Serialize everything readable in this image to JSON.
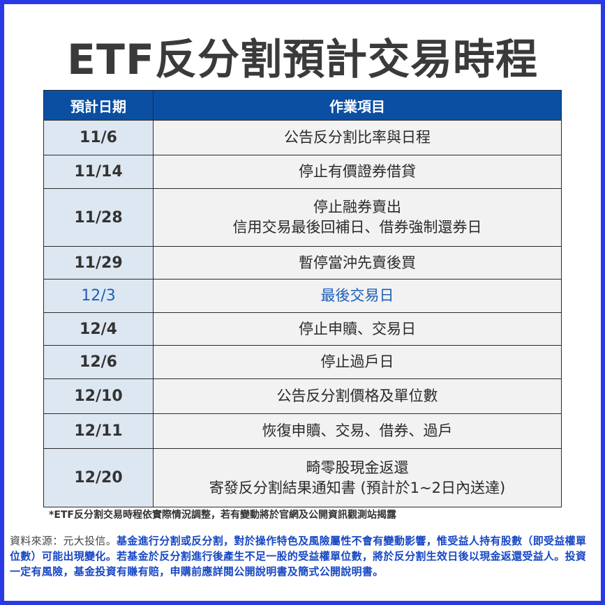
{
  "title": "ETF反分割預計交易時程",
  "table": {
    "headers": [
      "預計日期",
      "作業項目"
    ],
    "rows": [
      {
        "date": "11/6",
        "lines": [
          "公告反分割比率與日程"
        ]
      },
      {
        "date": "11/14",
        "lines": [
          "停止有價證券借貸"
        ]
      },
      {
        "date": "11/28",
        "lines": [
          "停止融券賣出",
          "信用交易最後回補日、借券強制還券日"
        ]
      },
      {
        "date": "11/29",
        "lines": [
          "暫停當沖先賣後買"
        ]
      },
      {
        "date": "12/3",
        "lines": [
          "最後交易日"
        ]
      },
      {
        "date": "12/4",
        "lines": [
          "停止申贖、交易日"
        ]
      },
      {
        "date": "12/6",
        "lines": [
          "停止過戶日"
        ]
      },
      {
        "date": "12/10",
        "lines": [
          "公告反分割價格及單位數"
        ]
      },
      {
        "date": "12/11",
        "lines": [
          "恢復申贖、交易、借券、過戶"
        ]
      },
      {
        "date": "12/20",
        "lines": [
          "畸零股現金返還",
          "寄發反分割結果通知書 (預計於1~2日內送達)"
        ]
      }
    ]
  },
  "note": "*ETF反分割交易時程依實際情況調整，若有變動將於官網及公開資訊觀測站揭露",
  "source": {
    "prefix": "資料來源：元大投信。",
    "body": "基金進行分割或反分割，對於操作特色及風險屬性不會有變動影響，惟受益人持有股數（即受益權單位數）可能出現變化。若基金於反分割進行後產生不足一股的受益權單位數，將於反分割生效日後以現金返還受益人。投資一定有風險，基金投資有賺有賠，申購前應詳閱公開說明書及簡式公開說明書。"
  },
  "colors": {
    "border": "#2a39e6",
    "header_bg": "#0b4fa3",
    "date_bg": "#dde7f2",
    "task_bg": "#f2f2f2",
    "highlight": "#1d5fb8",
    "disclaimer": "#1747c2"
  }
}
